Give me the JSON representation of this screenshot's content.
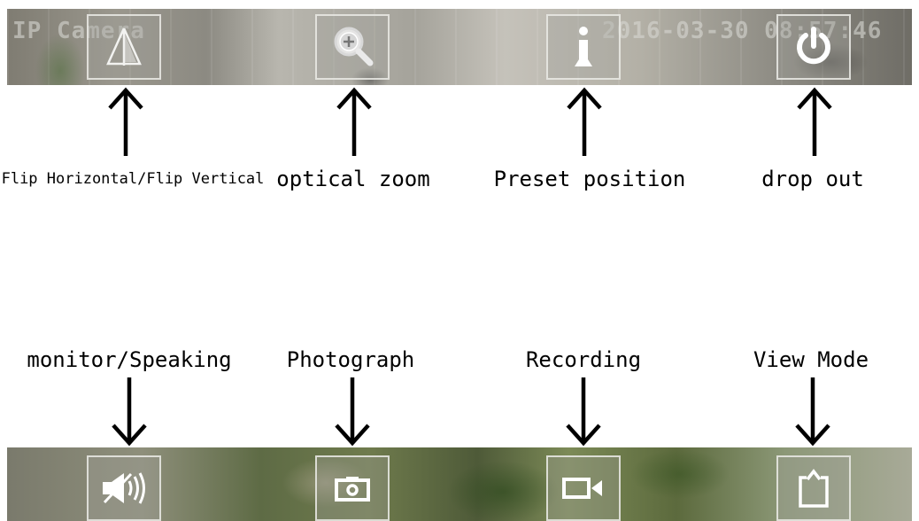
{
  "overlay": {
    "title": "IP Camera",
    "timestamp": "2016-03-30 08:57:46"
  },
  "top_controls": [
    {
      "icon": "flip-icon",
      "label": "Flip Horizontal/Flip Vertical"
    },
    {
      "icon": "zoom-in-icon",
      "label": "optical zoom"
    },
    {
      "icon": "preset-position-icon",
      "label": "Preset position"
    },
    {
      "icon": "power-icon",
      "label": "drop out"
    }
  ],
  "bottom_controls": [
    {
      "icon": "speaker-icon",
      "label": "monitor/Speaking"
    },
    {
      "icon": "camera-icon",
      "label": "Photograph"
    },
    {
      "icon": "video-camera-icon",
      "label": "Recording"
    },
    {
      "icon": "view-mode-icon",
      "label": "View Mode"
    }
  ]
}
